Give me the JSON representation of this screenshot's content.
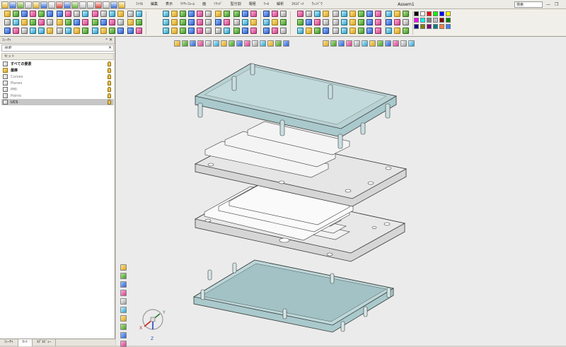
{
  "menu": {
    "items": [
      "ﾌｧｲﾙ",
      "編集",
      "表示",
      "ﾜｲﾔｰﾌﾚｰﾑ",
      "面",
      "ｿﾘｯﾄﾞ",
      "型分割",
      "電極",
      "ﾂｰﾙ",
      "解析",
      "ｴｷｽﾊﾟｰﾄ",
      "ｳｨﾝﾄﾞｳ"
    ]
  },
  "window": {
    "title": "Assem1",
    "search_label": "検索",
    "minimize": "—",
    "restore": "❐"
  },
  "panel": {
    "title": "ﾌｨｰﾁｬ",
    "pin": "ᵖ",
    "close": "✕",
    "search_placeholder": "検索",
    "set_header": "セット",
    "tree": [
      {
        "label": "すべての要素",
        "style": "bold",
        "db": false
      },
      {
        "label": "層庫",
        "style": "bold",
        "db": true
      },
      {
        "label": "Curves",
        "style": "gray",
        "db": false
      },
      {
        "label": "Planes",
        "style": "gray",
        "db": false
      },
      {
        "label": "PMI",
        "style": "gray",
        "db": false
      },
      {
        "label": "Points",
        "style": "gray",
        "db": false
      },
      {
        "label": "UCS",
        "style": "sel",
        "db": false
      }
    ],
    "tabs": [
      "ﾌｨｰﾁｬ",
      "ｾｯﾄ",
      "ﾓﾃﾞﾙﾋﾞｭｰ"
    ]
  },
  "axis": {
    "x": "X",
    "y": "Y",
    "z": "Z"
  },
  "colors": {
    "teal_fill": "#a9c9cc",
    "gray_fill": "#e4e4e4",
    "edge": "#3a3a3a"
  }
}
